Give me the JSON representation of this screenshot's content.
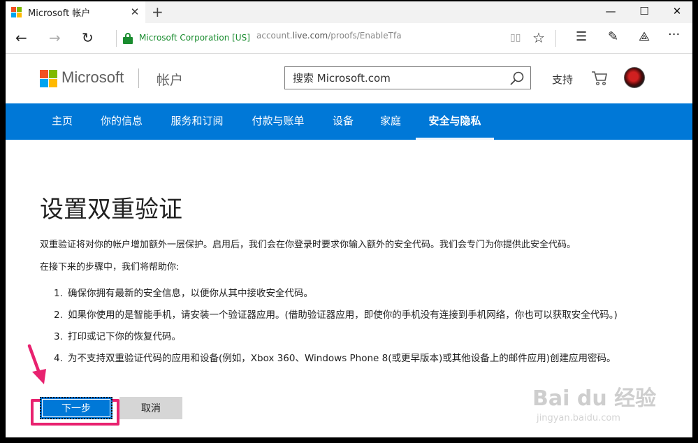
{
  "colors": {
    "ms_red": "#f25022",
    "ms_green": "#7fba00",
    "ms_blue": "#00a4ef",
    "ms_yellow": "#ffb900",
    "accent_blue": "#0078d7",
    "secure_green": "#1a8c2f",
    "highlight_pink": "#e8226f"
  },
  "browser": {
    "tab_title": "Microsoft 帐户",
    "tab_close_glyph": "✕",
    "new_tab_glyph": "+",
    "window_minimize_glyph": "—",
    "window_maximize_glyph": "☐",
    "window_close_glyph": "✕",
    "back_glyph": "←",
    "forward_glyph": "→",
    "refresh_glyph": "↻",
    "reading_view_glyph": "▯▯",
    "favorite_glyph": "☆",
    "hub_glyph": "☰",
    "note_glyph": "✎",
    "share_glyph": "⟁",
    "more_glyph": "···",
    "org_identity": "Microsoft Corporation [US]",
    "url_prefix": "account.",
    "url_domain": "live.com",
    "url_path": "/proofs/EnableTfa"
  },
  "header": {
    "brand": "Microsoft",
    "product": "帐户",
    "search_placeholder": "搜索 Microsoft.com",
    "support": "支持"
  },
  "nav": {
    "items": [
      {
        "label": "主页"
      },
      {
        "label": "你的信息"
      },
      {
        "label": "服务和订阅"
      },
      {
        "label": "付款与账单"
      },
      {
        "label": "设备"
      },
      {
        "label": "家庭"
      },
      {
        "label": "安全与隐私"
      }
    ],
    "active_index": 6
  },
  "content": {
    "title": "设置双重验证",
    "intro": "双重验证将对你的帐户增加额外一层保护。启用后，我们会在你登录时要求你输入额外的安全代码。我们会专门为你提供此安全代码。",
    "lead": "在接下来的步骤中，我们将帮助你:",
    "steps": [
      {
        "num": "1.",
        "text": "确保你拥有最新的安全信息，以便你从其中接收安全代码。"
      },
      {
        "num": "2.",
        "text": "如果你使用的是智能手机，请安装一个验证器应用。(借助验证器应用，即使你的手机没有连接到手机网络，你也可以获取安全代码。)"
      },
      {
        "num": "3.",
        "text": "打印或记下你的恢复代码。"
      },
      {
        "num": "4.",
        "text": "为不支持双重验证代码的应用和设备(例如，Xbox 360、Windows Phone 8(或更早版本)或其他设备上的邮件应用)创建应用密码。"
      }
    ],
    "next_button": "下一步",
    "cancel_button": "取消"
  },
  "watermark": {
    "main": "Bai du 经验",
    "sub": "jingyan.baidu.com"
  }
}
